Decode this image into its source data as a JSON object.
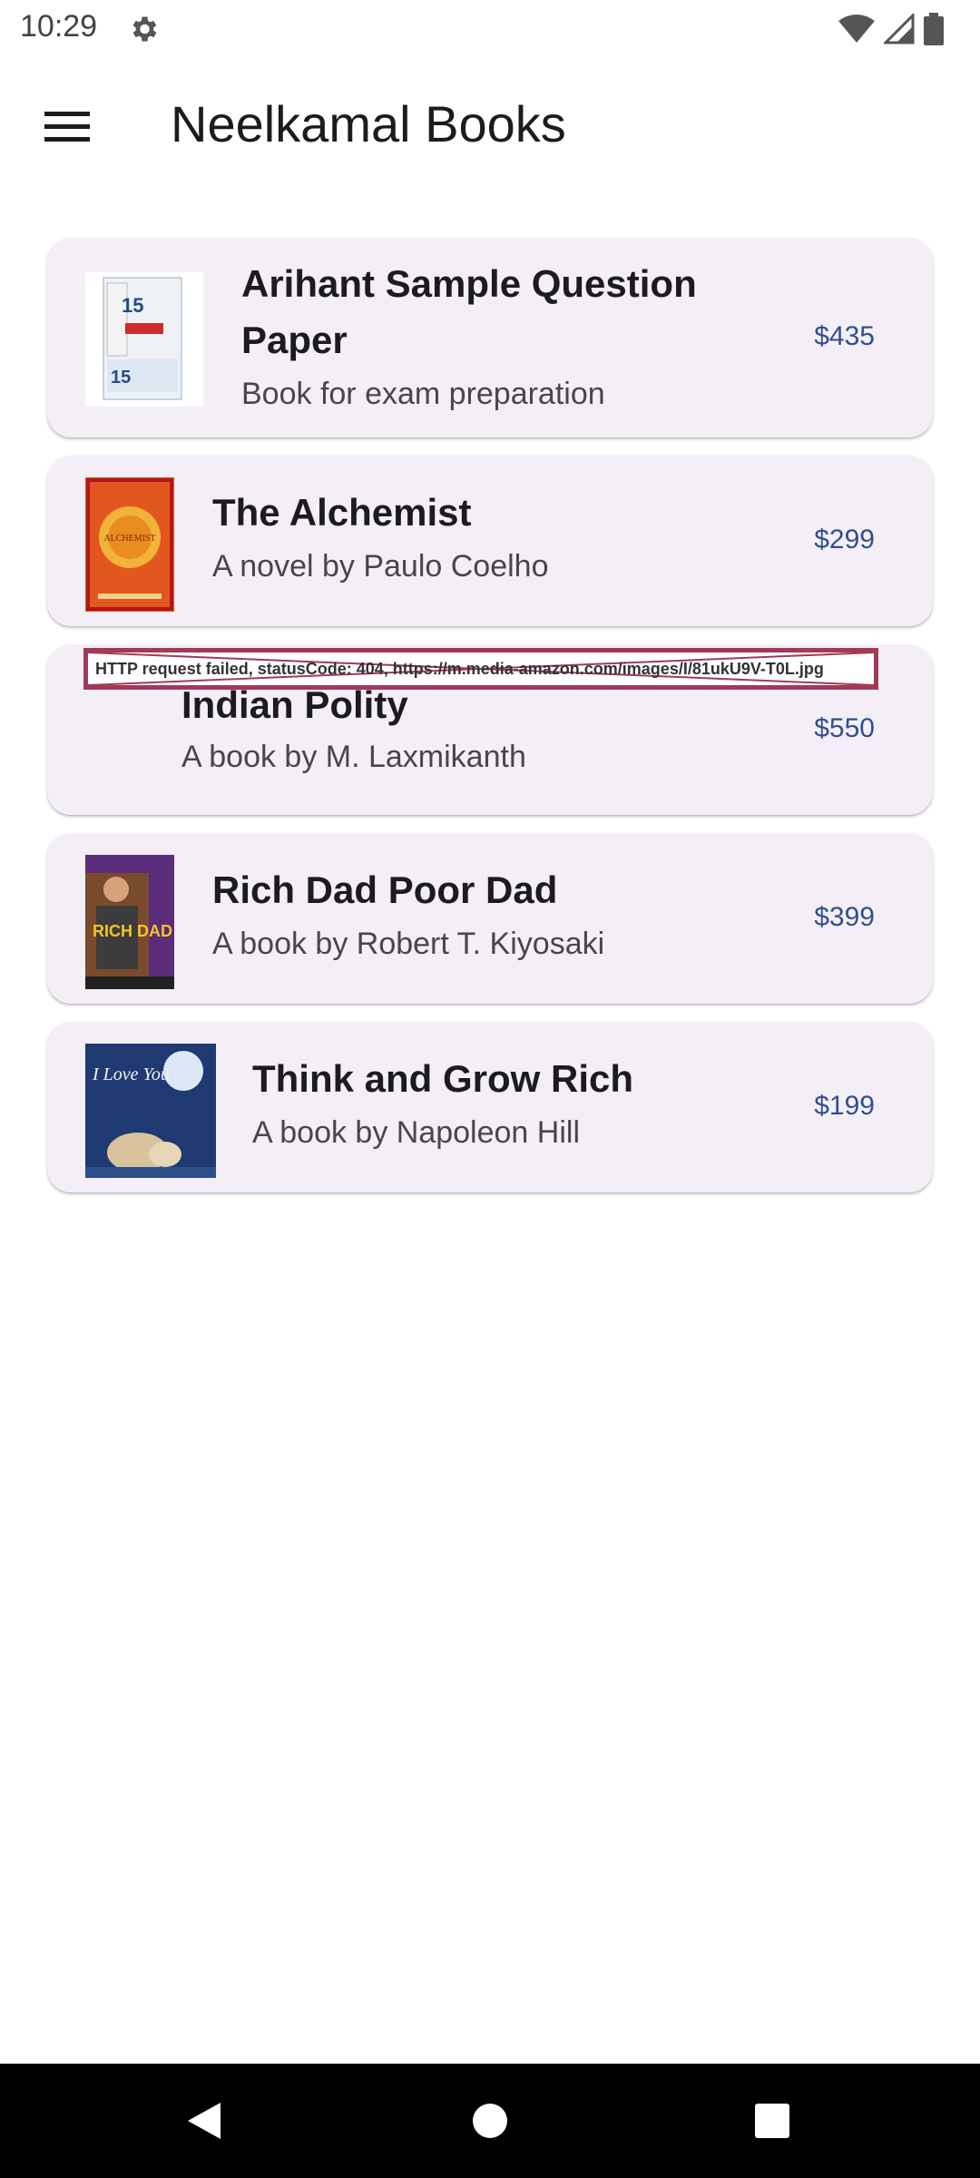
{
  "status_bar": {
    "time": "10:29",
    "icons": [
      "gear-icon",
      "wifi-icon",
      "signal-icon",
      "battery-icon"
    ]
  },
  "app_bar": {
    "title": "Neelkamal Books",
    "menu_icon": "hamburger-menu-icon"
  },
  "books": [
    {
      "title": "Arihant Sample Question Paper",
      "subtitle": "Book for exam preparation",
      "price": "$435",
      "cover_text": "15"
    },
    {
      "title": "The Alchemist",
      "subtitle": "A novel by Paulo Coelho",
      "price": "$299",
      "cover_text": "ALCHEMIST"
    },
    {
      "title": "Indian Polity",
      "subtitle": "A book by M. Laxmikanth",
      "price": "$550",
      "image_error": "HTTP request failed, statusCode: 404, https://m.media-amazon.com/images/I/81ukU9V-T0L.jpg"
    },
    {
      "title": "Rich Dad Poor Dad",
      "subtitle": "A book by Robert T. Kiyosaki",
      "price": "$399",
      "cover_text": "RICH DAD"
    },
    {
      "title": "Think and Grow Rich",
      "subtitle": "A book by Napoleon Hill",
      "price": "$199",
      "cover_text": "I Love You"
    }
  ],
  "nav_bar": {
    "icons": [
      "back-icon",
      "home-icon",
      "recents-icon"
    ]
  },
  "colors": {
    "card_background": "#f4eff6",
    "price": "#2f4f8f",
    "error_border": "#a23a55"
  }
}
